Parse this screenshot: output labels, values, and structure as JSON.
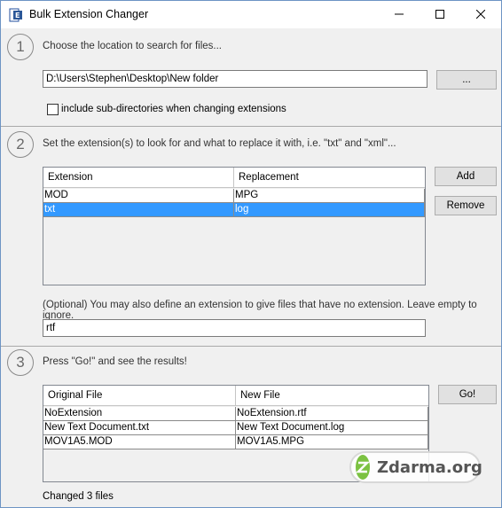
{
  "window": {
    "title": "Bulk Extension Changer",
    "minimize_icon": "minimize-icon",
    "maximize_icon": "maximize-icon",
    "close_icon": "close-icon"
  },
  "step1": {
    "number": "1",
    "text": "Choose the location to search for files...",
    "path_value": "D:\\Users\\Stephen\\Desktop\\New folder",
    "browse_label": "...",
    "subdir_label": "include sub-directories when changing extensions",
    "subdir_checked": false
  },
  "step2": {
    "number": "2",
    "text": "Set the extension(s) to look for and what to replace it with, i.e. \"txt\" and \"xml\"...",
    "columns": [
      "Extension",
      "Replacement"
    ],
    "rows": [
      {
        "extension": "MOD",
        "replacement": "MPG"
      },
      {
        "extension": "txt",
        "replacement": "log"
      }
    ],
    "selected_row": 1,
    "add_label": "Add",
    "remove_label": "Remove",
    "optional_text": "(Optional) You may also define an extension to give files that have no extension. Leave empty to ignore.",
    "optional_value": "rtf"
  },
  "step3": {
    "number": "3",
    "text": "Press \"Go!\" and see the results!",
    "go_label": "Go!",
    "columns": [
      "Original File",
      "New File"
    ],
    "rows": [
      {
        "original": "NoExtension",
        "new": "NoExtension.rtf"
      },
      {
        "original": "New Text Document.txt",
        "new": "New Text Document.log"
      },
      {
        "original": "MOV1A5.MOD",
        "new": "MOV1A5.MPG"
      }
    ],
    "status": "Changed 3 files"
  },
  "watermark": {
    "text": "Zdarma.org"
  },
  "colors": {
    "selection": "#3399ff",
    "watermark_green": "#7cc242"
  }
}
